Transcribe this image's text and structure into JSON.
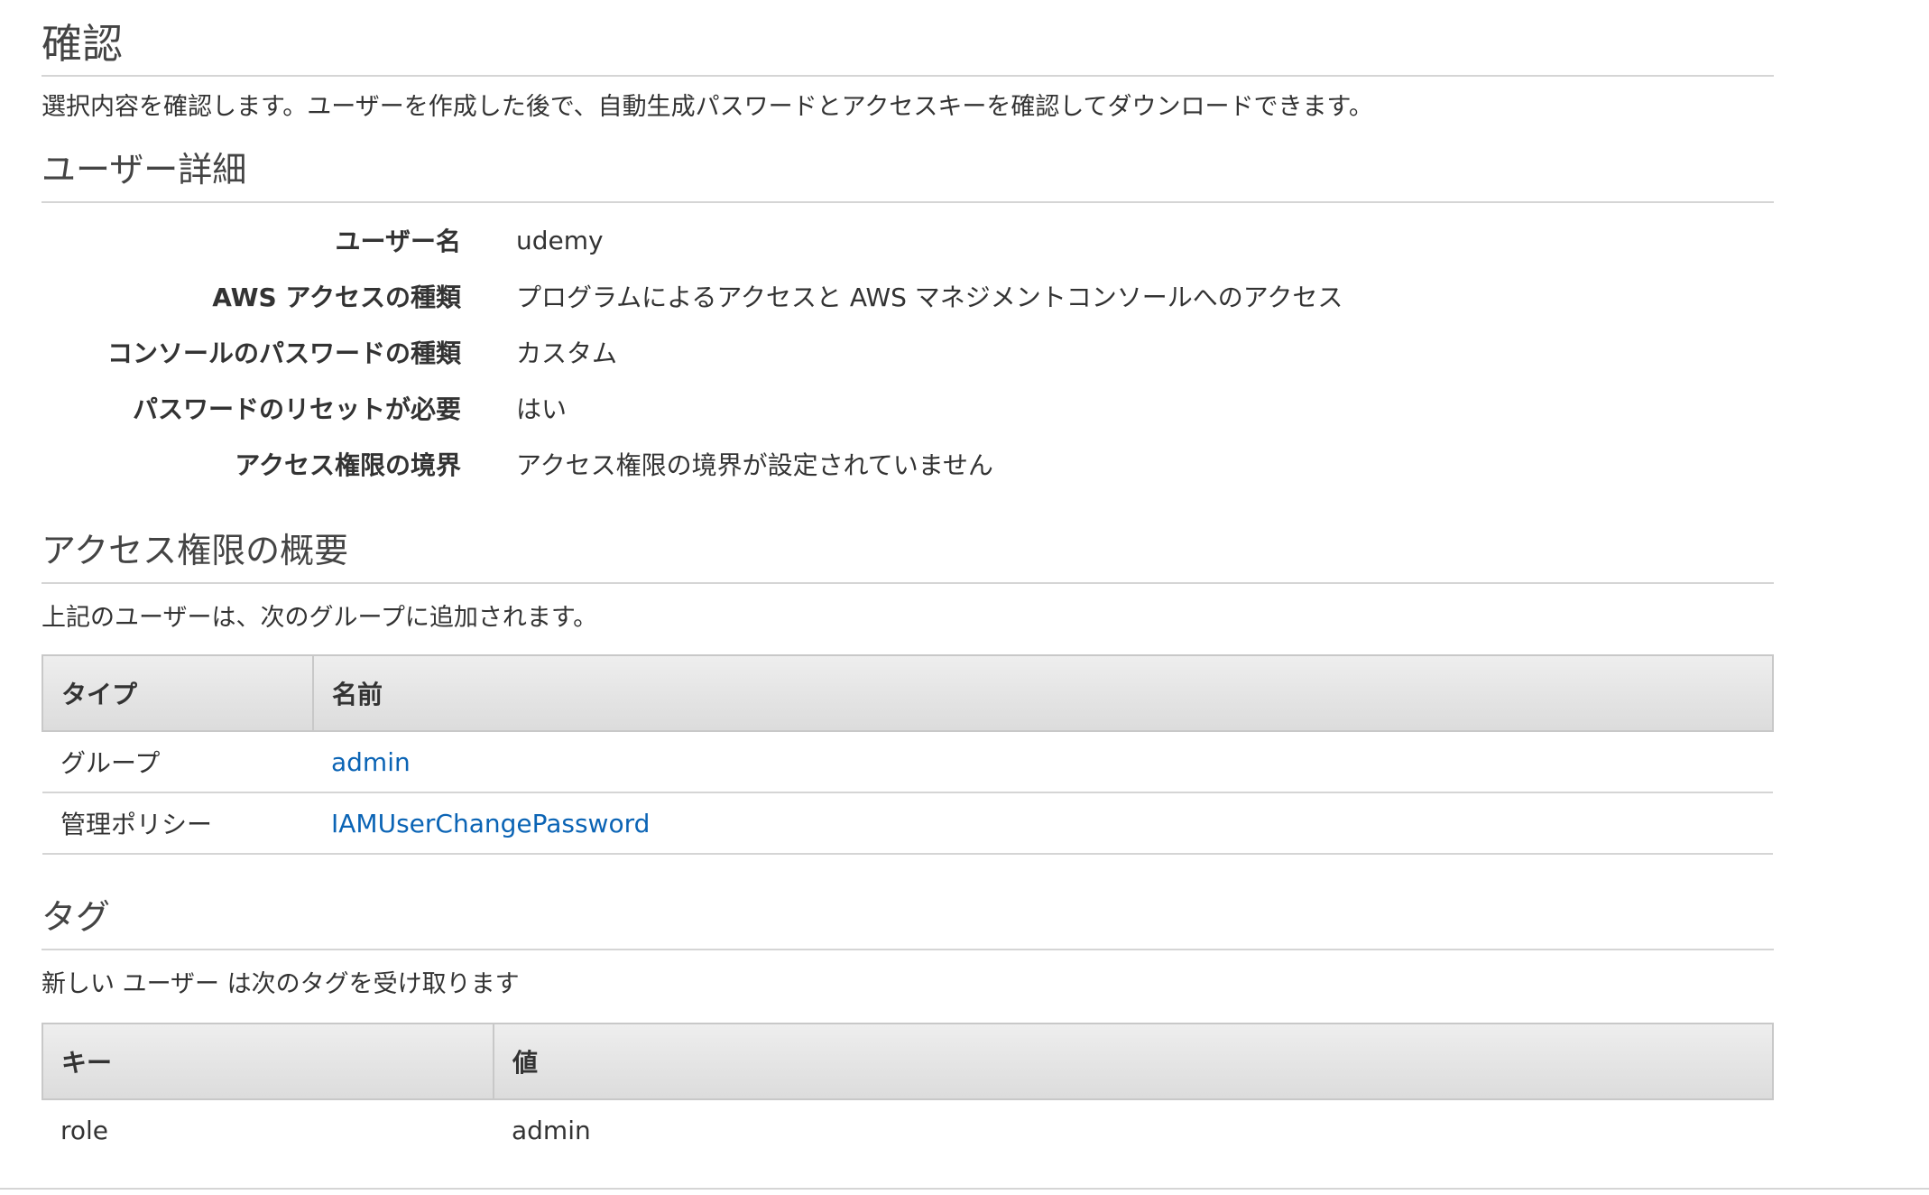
{
  "page": {
    "title": "確認",
    "intro": "選択内容を確認します。ユーザーを作成した後で、自動生成パスワードとアクセスキーを確認してダウンロードできます。"
  },
  "user_details": {
    "heading": "ユーザー詳細",
    "rows": [
      {
        "label": "ユーザー名",
        "value": "udemy"
      },
      {
        "label": "AWS アクセスの種類",
        "value": "プログラムによるアクセスと AWS マネジメントコンソールへのアクセス"
      },
      {
        "label": "コンソールのパスワードの種類",
        "value": "カスタム"
      },
      {
        "label": "パスワードのリセットが必要",
        "value": "はい"
      },
      {
        "label": "アクセス権限の境界",
        "value": "アクセス権限の境界が設定されていません"
      }
    ]
  },
  "permissions": {
    "heading": "アクセス権限の概要",
    "description": "上記のユーザーは、次のグループに追加されます。",
    "columns": [
      "タイプ",
      "名前"
    ],
    "rows": [
      {
        "type": "グループ",
        "name": "admin"
      },
      {
        "type": "管理ポリシー",
        "name": "IAMUserChangePassword"
      }
    ]
  },
  "tags": {
    "heading": "タグ",
    "description": "新しい ユーザー は次のタグを受け取ります",
    "columns": [
      "キー",
      "値"
    ],
    "rows": [
      {
        "key": "role",
        "value": "admin"
      }
    ]
  },
  "colors": {
    "link": "#0b64b5",
    "header_bg": "#e4e4e4",
    "divider": "#d5d5d5"
  }
}
